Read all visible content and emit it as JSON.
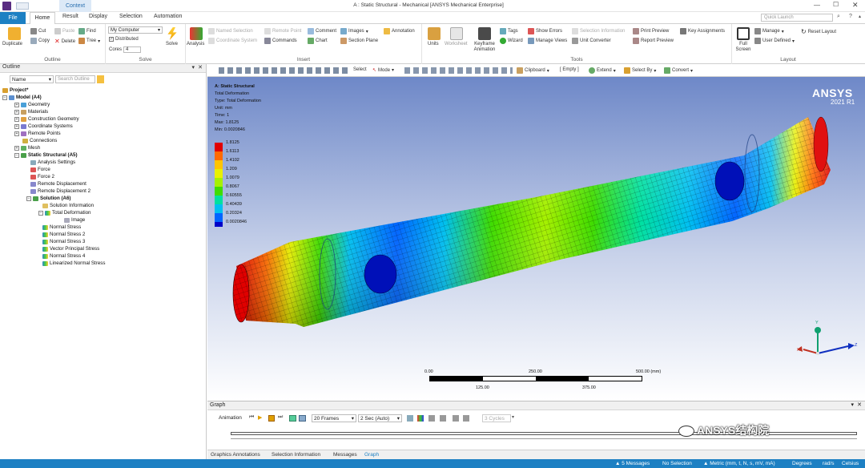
{
  "window": {
    "title": "A : Static Structural - Mechanical [ANSYS Mechanical Enterprise]",
    "context_tab": "Context"
  },
  "ribbon_tabs": [
    "File",
    "Home",
    "Result",
    "Display",
    "Selection",
    "Automation"
  ],
  "quick_launch_placeholder": "Quick Launch",
  "ribbon": {
    "outline": {
      "label": "Outline",
      "duplicate": "Duplicate",
      "cut": "Cut",
      "copy": "Copy",
      "paste": "Paste",
      "delete": "Delete",
      "find": "Find",
      "tree": "Tree"
    },
    "solve": {
      "label": "Solve",
      "computer": "My Computer",
      "distributed": "Distributed",
      "cores_label": "Cores",
      "cores_value": "4",
      "solve_btn": "Solve"
    },
    "insert": {
      "label": "Insert",
      "analysis": "Analysis",
      "named_selection": "Named Selection",
      "coordinate_system": "Coordinate System",
      "remote_point": "Remote Point",
      "commands": "Commands",
      "comment": "Comment",
      "chart": "Chart",
      "images": "Images",
      "section_plane": "Section Plane",
      "annotation": "Annotation"
    },
    "tools": {
      "label": "Tools",
      "units": "Units",
      "worksheet": "Worksheet",
      "keyframe_animation": "Keyframe Animation",
      "tags": "Tags",
      "wizard": "Wizard",
      "show_errors": "Show Errors",
      "manage_views": "Manage Views",
      "selection_information": "Selection Information",
      "unit_converter": "Unit Converter",
      "print_preview": "Print Preview",
      "report_preview": "Report Preview",
      "key_assignments": "Key Assignments"
    },
    "layout": {
      "label": "Layout",
      "full_screen": "Full Screen",
      "manage": "Manage",
      "user_defined": "User Defined",
      "reset_layout": "Reset Layout"
    }
  },
  "outline": {
    "title": "Outline",
    "name_header": "Name",
    "search_placeholder": "Search Outline",
    "tree": [
      {
        "label": "Project*",
        "bold": true
      },
      {
        "label": "Model (A4)",
        "bold": true
      },
      {
        "label": "Geometry"
      },
      {
        "label": "Materials"
      },
      {
        "label": "Construction Geometry"
      },
      {
        "label": "Coordinate Systems"
      },
      {
        "label": "Remote Points"
      },
      {
        "label": "Connections"
      },
      {
        "label": "Mesh"
      },
      {
        "label": "Static Structural (A5)",
        "bold": true
      },
      {
        "label": "Analysis Settings"
      },
      {
        "label": "Force"
      },
      {
        "label": "Force 2"
      },
      {
        "label": "Remote Displacement"
      },
      {
        "label": "Remote Displacement 2"
      },
      {
        "label": "Solution (A6)",
        "bold": true
      },
      {
        "label": "Solution Information"
      },
      {
        "label": "Total Deformation"
      },
      {
        "label": "Image"
      },
      {
        "label": "Normal Stress"
      },
      {
        "label": "Normal Stress 2"
      },
      {
        "label": "Normal Stress 3"
      },
      {
        "label": "Vector Principal Stress"
      },
      {
        "label": "Normal Stress 4"
      },
      {
        "label": "Linearized Normal Stress"
      }
    ]
  },
  "graphics_toolbar": {
    "select": "Select",
    "mode": "Mode",
    "clipboard": "Clipboard",
    "empty": "[ Empty ]",
    "extend": "Extend",
    "select_by": "Select By",
    "convert": "Convert"
  },
  "viewport": {
    "info": [
      "A: Static Structural",
      "Total Deformation",
      "Type: Total Deformation",
      "Unit: mm",
      "Time: 1",
      "Max: 1.8125",
      "Min: 0.0020846"
    ],
    "brand": "ANSYS",
    "version": "2021 R1",
    "legend": [
      {
        "value": "1.8125",
        "color": "#e00000"
      },
      {
        "value": "1.6113",
        "color": "#ff6a00"
      },
      {
        "value": "1.4102",
        "color": "#ffc400"
      },
      {
        "value": "1.209",
        "color": "#e8f000"
      },
      {
        "value": "1.0079",
        "color": "#a6f000"
      },
      {
        "value": "0.8067",
        "color": "#3fdc00"
      },
      {
        "value": "0.60555",
        "color": "#00e0a0"
      },
      {
        "value": "0.40439",
        "color": "#00c0f0"
      },
      {
        "value": "0.20324",
        "color": "#0064ff"
      },
      {
        "value": "0.0020846",
        "color": "#0000c8"
      }
    ],
    "scale": {
      "top_labels": [
        "0.00",
        "250.00",
        "500.00 (mm)"
      ],
      "bottom_labels": [
        "125.00",
        "375.00"
      ]
    },
    "axis_labels": {
      "x": "X",
      "y": "Y",
      "z": "Z"
    }
  },
  "graph_panel": {
    "title": "Graph",
    "animation": "Animation",
    "frames": "20 Frames",
    "duration": "2 Sec (Auto)",
    "cycles": "3 Cycles",
    "watermark": "ANSYS结构院"
  },
  "bottom_tabs": [
    "Graphics Annotations",
    "Selection Information",
    "Messages",
    "Graph"
  ],
  "status": {
    "messages": "5 Messages",
    "selection": "No Selection",
    "units": "Metric (mm, t, N, s, mV, mA)",
    "angle": "Degrees",
    "rate": "rad/s",
    "temp": "Celsius"
  },
  "colors": {
    "file_tab": "#1d80c3",
    "status_bar": "#1d80c3",
    "accent": "#1d80c3"
  }
}
